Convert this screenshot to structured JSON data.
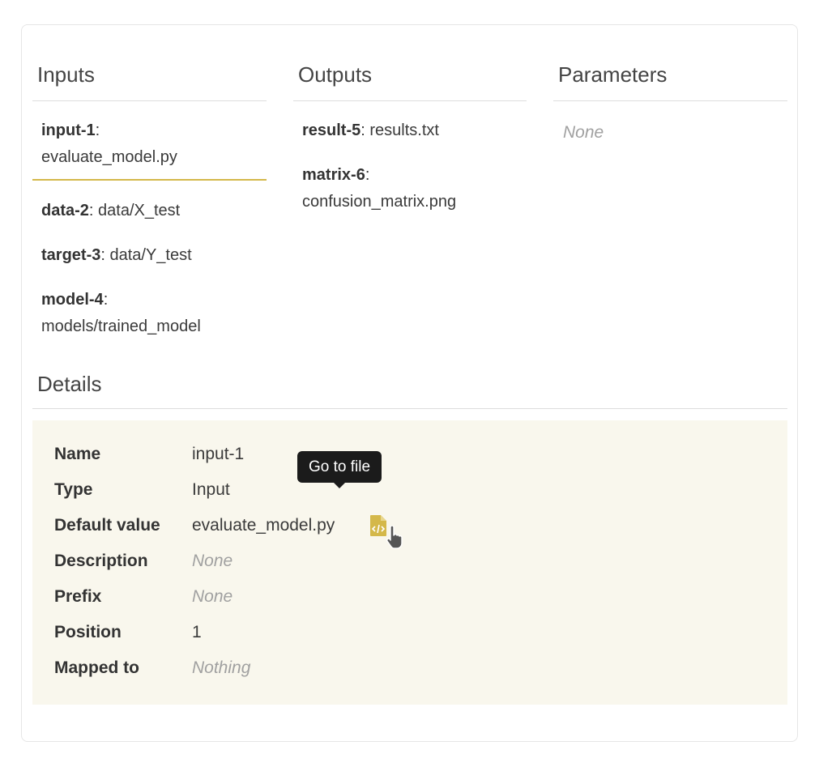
{
  "inputs": {
    "title": "Inputs",
    "items": [
      {
        "name": "input-1",
        "value": "evaluate_model.py"
      },
      {
        "name": "data-2",
        "value": "data/X_test"
      },
      {
        "name": "target-3",
        "value": "data/Y_test"
      },
      {
        "name": "model-4",
        "value": "models/trained_model"
      }
    ]
  },
  "outputs": {
    "title": "Outputs",
    "items": [
      {
        "name": "result-5",
        "value": "results.txt"
      },
      {
        "name": "matrix-6",
        "value": "confusion_matrix.png"
      }
    ]
  },
  "parameters": {
    "title": "Parameters",
    "empty_text": "None"
  },
  "details": {
    "title": "Details",
    "rows": [
      {
        "label": "Name",
        "value": "input-1"
      },
      {
        "label": "Type",
        "value": "Input"
      },
      {
        "label": "Default value",
        "value": "evaluate_model.py"
      },
      {
        "label": "Description",
        "value": "None"
      },
      {
        "label": "Prefix",
        "value": "None"
      },
      {
        "label": "Position",
        "value": "1"
      },
      {
        "label": "Mapped to",
        "value": "Nothing"
      }
    ],
    "tooltip": "Go to file"
  },
  "colors": {
    "accent": "#d4b84a",
    "details_bg": "#f9f7ed",
    "file_icon": "#d4b84a"
  },
  "icons": {
    "file": "file-code-icon",
    "cursor": "pointer-cursor-icon"
  }
}
